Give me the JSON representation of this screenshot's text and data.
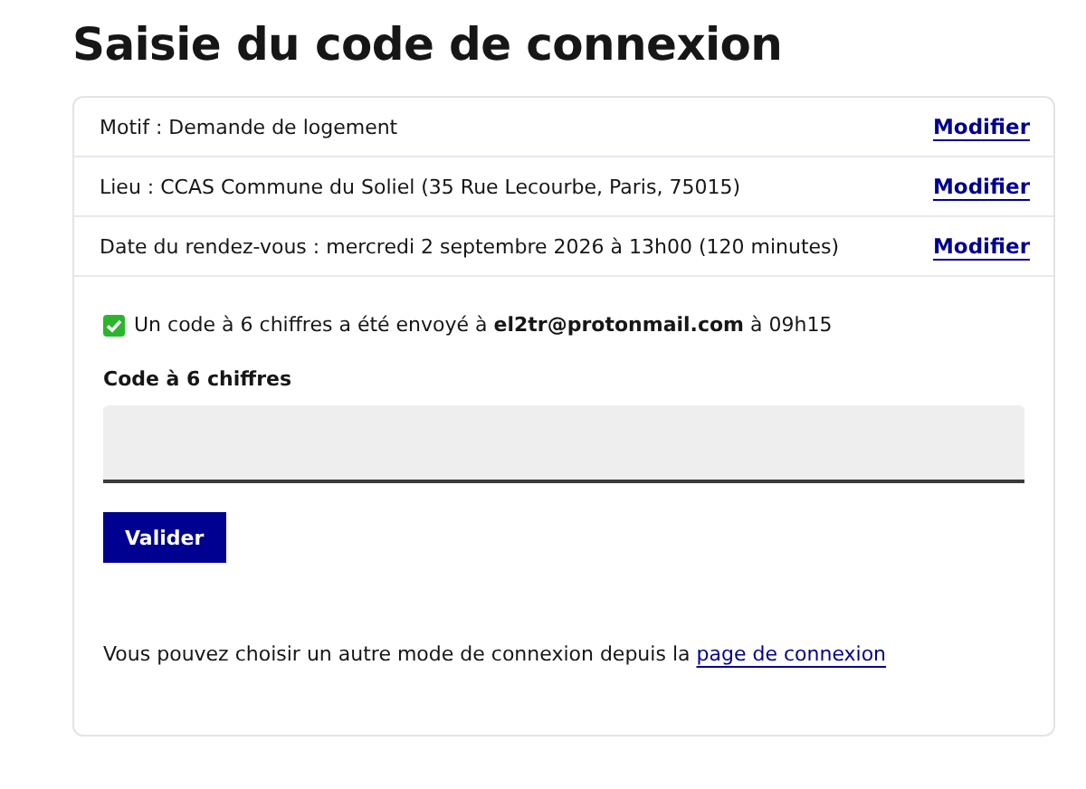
{
  "title": "Saisie du code de connexion",
  "summary": [
    {
      "text": "Motif : Demande de logement",
      "action": "Modifier"
    },
    {
      "text": "Lieu : CCAS Commune du Soliel (35 Rue Lecourbe, Paris, 75015)",
      "action": "Modifier"
    },
    {
      "text": "Date du rendez-vous : mercredi 2 septembre 2026 à 13h00 (120 minutes)",
      "action": "Modifier"
    }
  ],
  "notice": "Un code à 6 chiffres a été envoyé à **el2tr@protonmail.com** à 09h15",
  "code_field": {
    "label": "Code à 6 chiffres"
  },
  "submit": "Valider",
  "footer": {
    "text": "Vous pouvez choisir un autre mode de connexion depuis la",
    "link": "page de connexion"
  }
}
